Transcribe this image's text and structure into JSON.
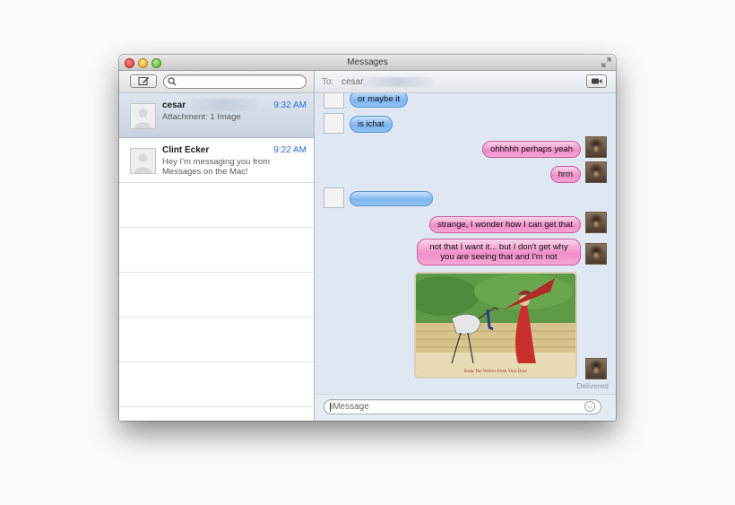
{
  "window": {
    "title": "Messages"
  },
  "sidebar": {
    "conversations": [
      {
        "name": "cesar",
        "time": "9:32 AM",
        "preview": "Attachment: 1 Image",
        "selected": true
      },
      {
        "name": "Clint Ecker",
        "time": "9:22 AM",
        "preview": "Hey I'm messaging you from Messages on the Mac!",
        "selected": false
      }
    ]
  },
  "chat": {
    "to_label": "To:",
    "recipient": "cesar",
    "messages": [
      {
        "side": "left",
        "text": "or maybe it"
      },
      {
        "side": "left",
        "text": "is ichat"
      },
      {
        "side": "right",
        "text": "ohhhhh perhaps yeah"
      },
      {
        "side": "right",
        "text": "hrm"
      },
      {
        "side": "left",
        "text": ""
      },
      {
        "side": "right",
        "text": "strange, I wonder how I can get that"
      },
      {
        "side": "right",
        "text": "not that I want it... but I don't get why you are seeing that and I'm not"
      }
    ],
    "attachment_caption": "Keep The Wolves From Your Door",
    "status": "Delivered",
    "input_placeholder": "iMessage"
  },
  "colors": {
    "sent_bubble": "#ef8fc8",
    "received_bubble": "#7fb6ef",
    "time_text": "#2a6fd8",
    "selected_row": "#c9d2e0"
  },
  "icons": [
    "compose-icon",
    "search-icon",
    "video-camera-icon",
    "fullscreen-icon",
    "emoji-icon"
  ]
}
